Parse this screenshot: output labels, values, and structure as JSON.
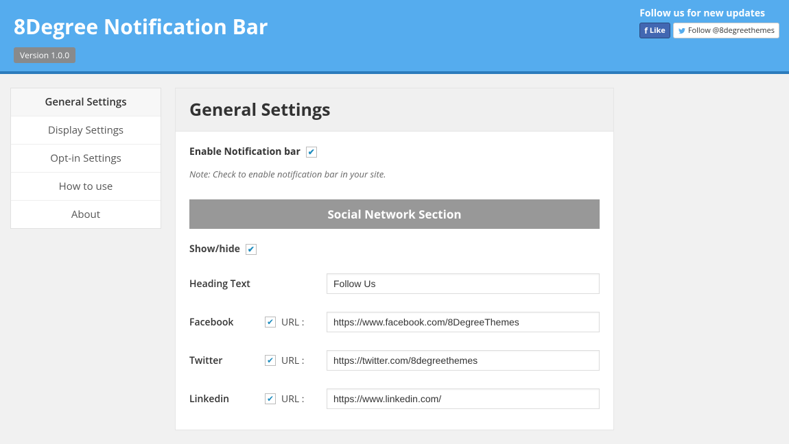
{
  "header": {
    "title": "8Degree Notification Bar",
    "version_badge": "Version 1.0.0",
    "follow_text": "Follow us for new updates",
    "fb_like": "Like",
    "tw_follow": "Follow @8degreethemes"
  },
  "sidebar": {
    "items": [
      {
        "label": "General Settings",
        "active": true
      },
      {
        "label": "Display Settings",
        "active": false
      },
      {
        "label": "Opt-in Settings",
        "active": false
      },
      {
        "label": "How to use",
        "active": false
      },
      {
        "label": "About",
        "active": false
      }
    ]
  },
  "panel": {
    "title": "General Settings",
    "enable_label": "Enable Notification bar",
    "enable_checked": true,
    "note": "Note: Check to enable notification bar in your site.",
    "social": {
      "section_title": "Social Network Section",
      "showhide_label": "Show/hide",
      "showhide_checked": true,
      "heading_label": "Heading Text",
      "heading_value": "Follow Us",
      "url_label": "URL :",
      "networks": [
        {
          "name": "Facebook",
          "checked": true,
          "url": "https://www.facebook.com/8DegreeThemes"
        },
        {
          "name": "Twitter",
          "checked": true,
          "url": "https://twitter.com/8degreethemes"
        },
        {
          "name": "Linkedin",
          "checked": true,
          "url": "https://www.linkedin.com/"
        }
      ]
    }
  }
}
